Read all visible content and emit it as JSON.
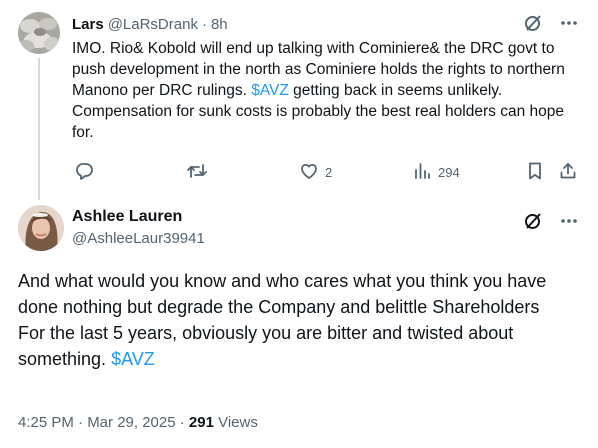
{
  "reply": {
    "author_name": "Lars",
    "author_handle": "@LaRsDrank",
    "separator": "·",
    "time": "8h",
    "body_text": "IMO. Rio& Kobold will end up talking with Cominiere& the DRC govt to push development in the north as Cominiere holds the rights to northern Manono per DRC rulings. ",
    "cashtag": "$AVZ",
    "body_text_after": " getting back in seems unlikely. Compensation for sunk costs is probably the best real holders can hope for.",
    "actions": {
      "reply_count": "",
      "retweet_count": "",
      "like_count": "2",
      "views_count": "294"
    }
  },
  "main_tweet": {
    "author_name": "Ashlee Lauren",
    "author_handle": "@AshleeLaur39941",
    "body_text": "And what would you know and who cares what you think you have done nothing but degrade the Company and belittle Shareholders\nFor the last 5 years, obviously you are bitter and twisted about something. ",
    "cashtag": "$AVZ",
    "timestamp": "4:25 PM · Mar 29, 2025 · ",
    "views_count": "291",
    "views_label": " Views"
  },
  "icons": {
    "grok": "grok-slash-circle-icon",
    "more": "more-dots-icon",
    "reply": "reply-bubble-icon",
    "retweet": "retweet-arrows-icon",
    "like": "heart-icon",
    "views": "views-bars-icon",
    "bookmark": "bookmark-icon",
    "share": "share-upload-icon"
  },
  "colors": {
    "text_primary": "#0f1419",
    "text_secondary": "#536471",
    "accent": "#1d9bf0",
    "thread_line": "#cfd9de"
  }
}
